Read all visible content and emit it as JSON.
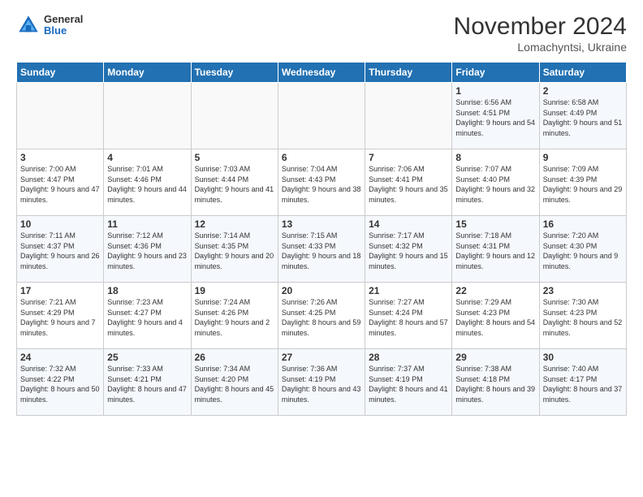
{
  "header": {
    "logo_general": "General",
    "logo_blue": "Blue",
    "month_title": "November 2024",
    "location": "Lomachyntsi, Ukraine"
  },
  "days_of_week": [
    "Sunday",
    "Monday",
    "Tuesday",
    "Wednesday",
    "Thursday",
    "Friday",
    "Saturday"
  ],
  "weeks": [
    [
      {
        "day": "",
        "info": ""
      },
      {
        "day": "",
        "info": ""
      },
      {
        "day": "",
        "info": ""
      },
      {
        "day": "",
        "info": ""
      },
      {
        "day": "",
        "info": ""
      },
      {
        "day": "1",
        "info": "Sunrise: 6:56 AM\nSunset: 4:51 PM\nDaylight: 9 hours and 54 minutes."
      },
      {
        "day": "2",
        "info": "Sunrise: 6:58 AM\nSunset: 4:49 PM\nDaylight: 9 hours and 51 minutes."
      }
    ],
    [
      {
        "day": "3",
        "info": "Sunrise: 7:00 AM\nSunset: 4:47 PM\nDaylight: 9 hours and 47 minutes."
      },
      {
        "day": "4",
        "info": "Sunrise: 7:01 AM\nSunset: 4:46 PM\nDaylight: 9 hours and 44 minutes."
      },
      {
        "day": "5",
        "info": "Sunrise: 7:03 AM\nSunset: 4:44 PM\nDaylight: 9 hours and 41 minutes."
      },
      {
        "day": "6",
        "info": "Sunrise: 7:04 AM\nSunset: 4:43 PM\nDaylight: 9 hours and 38 minutes."
      },
      {
        "day": "7",
        "info": "Sunrise: 7:06 AM\nSunset: 4:41 PM\nDaylight: 9 hours and 35 minutes."
      },
      {
        "day": "8",
        "info": "Sunrise: 7:07 AM\nSunset: 4:40 PM\nDaylight: 9 hours and 32 minutes."
      },
      {
        "day": "9",
        "info": "Sunrise: 7:09 AM\nSunset: 4:39 PM\nDaylight: 9 hours and 29 minutes."
      }
    ],
    [
      {
        "day": "10",
        "info": "Sunrise: 7:11 AM\nSunset: 4:37 PM\nDaylight: 9 hours and 26 minutes."
      },
      {
        "day": "11",
        "info": "Sunrise: 7:12 AM\nSunset: 4:36 PM\nDaylight: 9 hours and 23 minutes."
      },
      {
        "day": "12",
        "info": "Sunrise: 7:14 AM\nSunset: 4:35 PM\nDaylight: 9 hours and 20 minutes."
      },
      {
        "day": "13",
        "info": "Sunrise: 7:15 AM\nSunset: 4:33 PM\nDaylight: 9 hours and 18 minutes."
      },
      {
        "day": "14",
        "info": "Sunrise: 7:17 AM\nSunset: 4:32 PM\nDaylight: 9 hours and 15 minutes."
      },
      {
        "day": "15",
        "info": "Sunrise: 7:18 AM\nSunset: 4:31 PM\nDaylight: 9 hours and 12 minutes."
      },
      {
        "day": "16",
        "info": "Sunrise: 7:20 AM\nSunset: 4:30 PM\nDaylight: 9 hours and 9 minutes."
      }
    ],
    [
      {
        "day": "17",
        "info": "Sunrise: 7:21 AM\nSunset: 4:29 PM\nDaylight: 9 hours and 7 minutes."
      },
      {
        "day": "18",
        "info": "Sunrise: 7:23 AM\nSunset: 4:27 PM\nDaylight: 9 hours and 4 minutes."
      },
      {
        "day": "19",
        "info": "Sunrise: 7:24 AM\nSunset: 4:26 PM\nDaylight: 9 hours and 2 minutes."
      },
      {
        "day": "20",
        "info": "Sunrise: 7:26 AM\nSunset: 4:25 PM\nDaylight: 8 hours and 59 minutes."
      },
      {
        "day": "21",
        "info": "Sunrise: 7:27 AM\nSunset: 4:24 PM\nDaylight: 8 hours and 57 minutes."
      },
      {
        "day": "22",
        "info": "Sunrise: 7:29 AM\nSunset: 4:23 PM\nDaylight: 8 hours and 54 minutes."
      },
      {
        "day": "23",
        "info": "Sunrise: 7:30 AM\nSunset: 4:23 PM\nDaylight: 8 hours and 52 minutes."
      }
    ],
    [
      {
        "day": "24",
        "info": "Sunrise: 7:32 AM\nSunset: 4:22 PM\nDaylight: 8 hours and 50 minutes."
      },
      {
        "day": "25",
        "info": "Sunrise: 7:33 AM\nSunset: 4:21 PM\nDaylight: 8 hours and 47 minutes."
      },
      {
        "day": "26",
        "info": "Sunrise: 7:34 AM\nSunset: 4:20 PM\nDaylight: 8 hours and 45 minutes."
      },
      {
        "day": "27",
        "info": "Sunrise: 7:36 AM\nSunset: 4:19 PM\nDaylight: 8 hours and 43 minutes."
      },
      {
        "day": "28",
        "info": "Sunrise: 7:37 AM\nSunset: 4:19 PM\nDaylight: 8 hours and 41 minutes."
      },
      {
        "day": "29",
        "info": "Sunrise: 7:38 AM\nSunset: 4:18 PM\nDaylight: 8 hours and 39 minutes."
      },
      {
        "day": "30",
        "info": "Sunrise: 7:40 AM\nSunset: 4:17 PM\nDaylight: 8 hours and 37 minutes."
      }
    ]
  ]
}
